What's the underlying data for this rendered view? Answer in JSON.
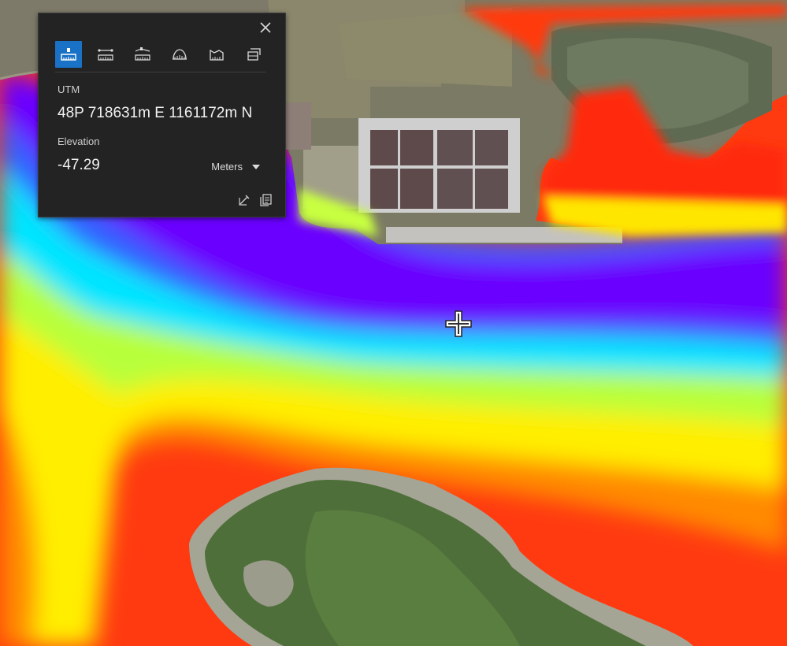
{
  "widget": {
    "tools": [
      {
        "name": "location-tool-icon",
        "active": true
      },
      {
        "name": "distance-tool-icon",
        "active": false
      },
      {
        "name": "elevation-profile-tool-icon",
        "active": false
      },
      {
        "name": "area-tool-icon",
        "active": false
      },
      {
        "name": "volume-tool-icon",
        "active": false
      },
      {
        "name": "slice-tool-icon",
        "active": false
      }
    ],
    "coordinate_label": "UTM",
    "coordinate_value": "48P 718631m E 1161172m N",
    "elevation_label": "Elevation",
    "elevation_value": "-47.29",
    "units_selected": "Meters"
  },
  "colors": {
    "panel_bg": "#232323",
    "accent": "#1a72c7",
    "deep_water": "#6a00ff",
    "shallow_water": "#ff2a00"
  }
}
